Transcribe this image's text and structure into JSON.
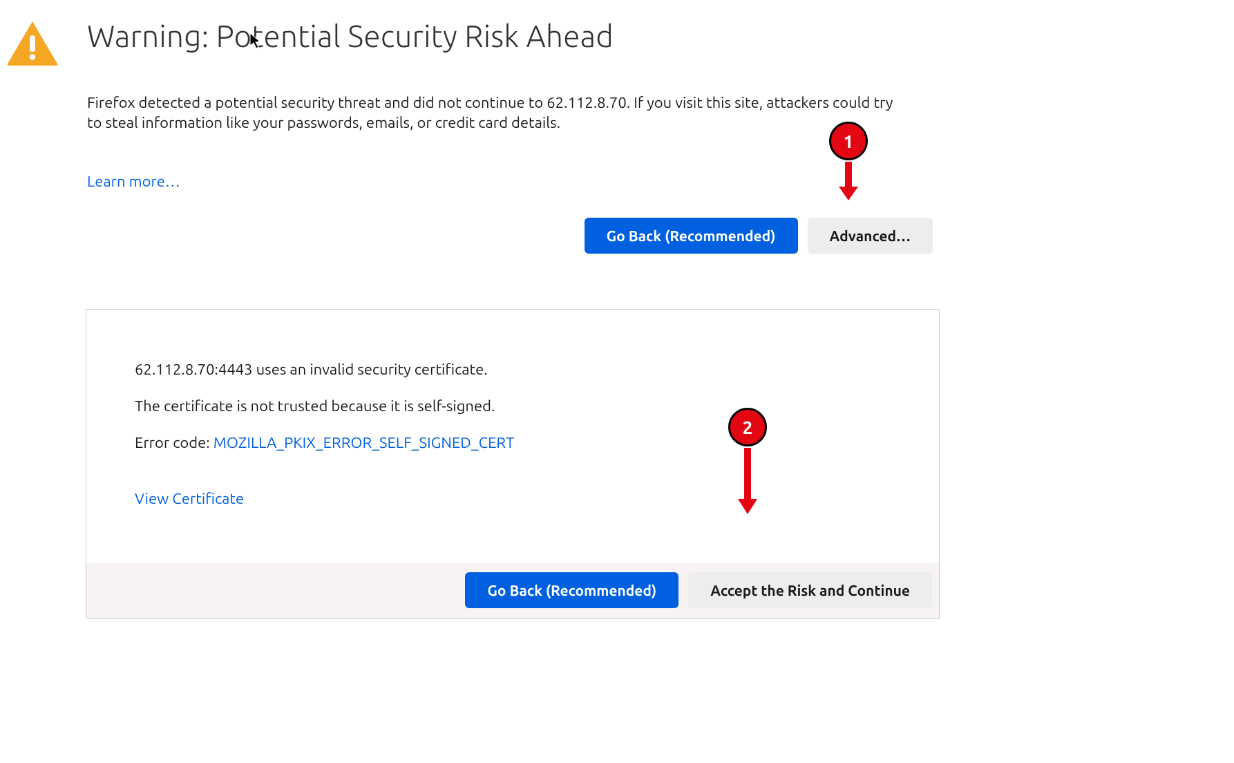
{
  "warning": {
    "title": "Warning: Potential Security Risk Ahead",
    "description": "Firefox detected a potential security threat and did not continue to 62.112.8.70. If you visit this site, attackers could try to steal information like your passwords, emails, or credit card details.",
    "learn_more": "Learn more…"
  },
  "buttons": {
    "go_back": "Go Back (Recommended)",
    "advanced": "Advanced…",
    "accept_risk": "Accept the Risk and Continue"
  },
  "advanced": {
    "invalid_cert": "62.112.8.70:4443 uses an invalid security certificate.",
    "not_trusted": "The certificate is not trusted because it is self-signed.",
    "error_code_label": "Error code: ",
    "error_code": "MOZILLA_PKIX_ERROR_SELF_SIGNED_CERT",
    "view_certificate": "View Certificate"
  },
  "callouts": {
    "one": "1",
    "two": "2"
  }
}
